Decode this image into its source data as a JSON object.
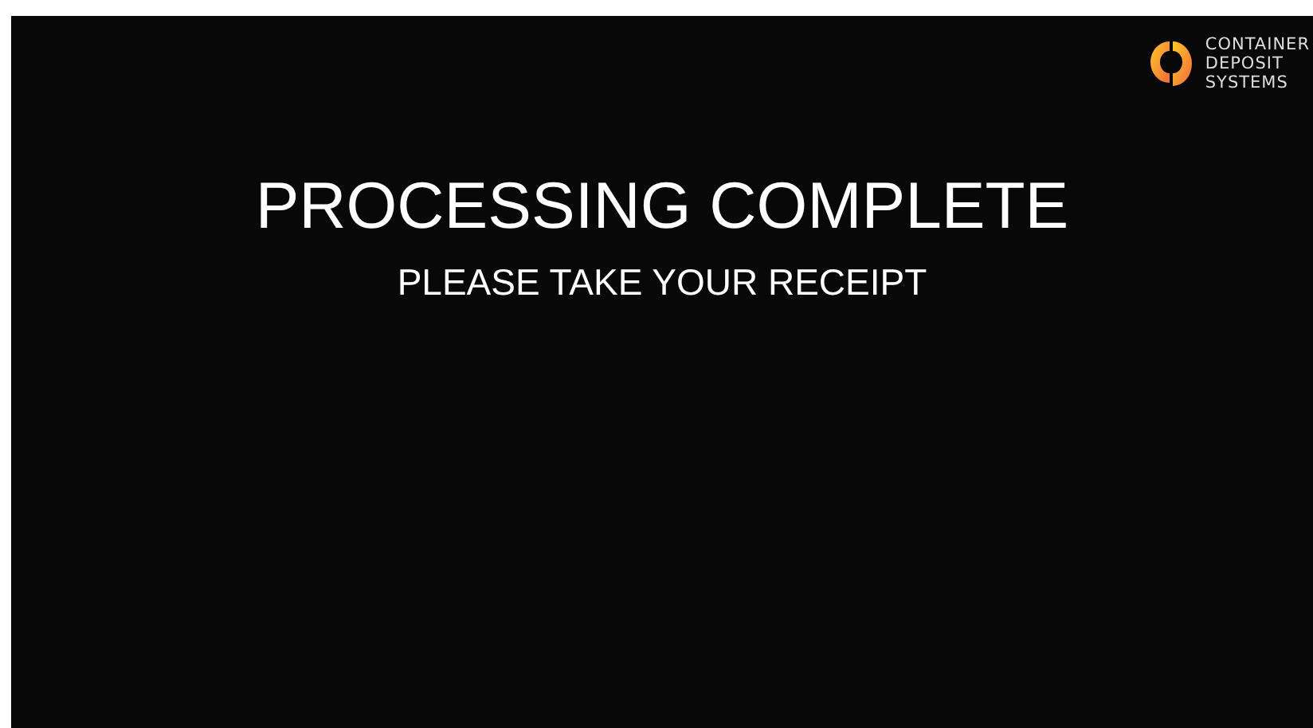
{
  "logo": {
    "lines": [
      "CONTAINER",
      "DEPOSIT",
      "SYSTEMS"
    ]
  },
  "message": {
    "title": "PROCESSING COMPLETE",
    "subtitle": "PLEASE TAKE YOUR RECEIPT"
  }
}
